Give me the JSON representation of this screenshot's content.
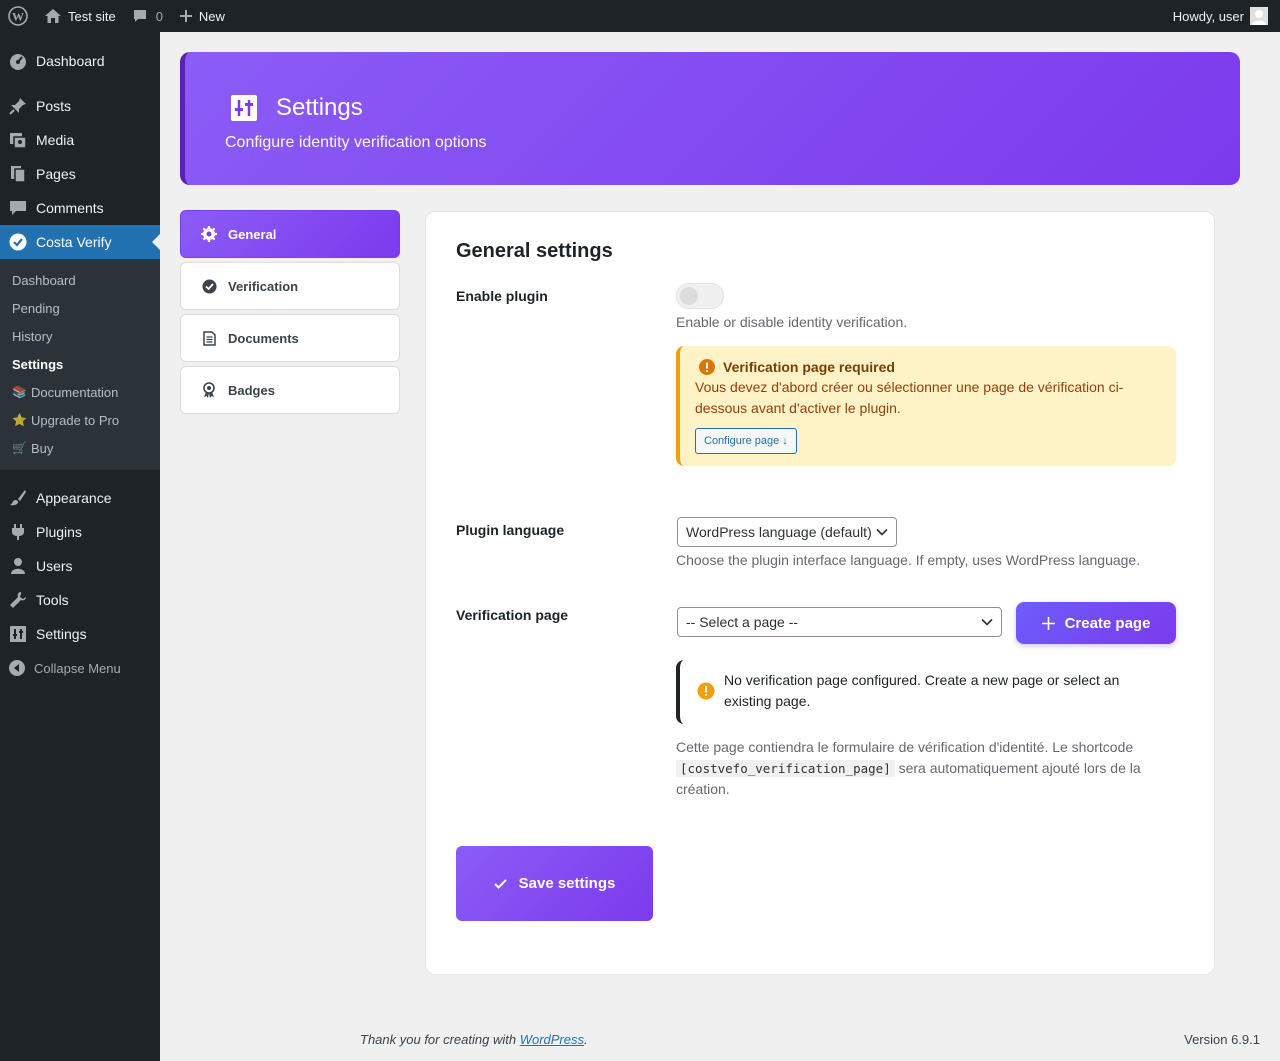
{
  "adminbar": {
    "site_name": "Test site",
    "comments_count": "0",
    "new_label": "New",
    "howdy": "Howdy, user"
  },
  "sidebar": {
    "items": [
      {
        "label": "Dashboard",
        "icon": "dashboard-icon"
      },
      {
        "label": "Posts",
        "icon": "pin-icon"
      },
      {
        "label": "Media",
        "icon": "media-icon"
      },
      {
        "label": "Pages",
        "icon": "pages-icon"
      },
      {
        "label": "Comments",
        "icon": "comment-icon"
      },
      {
        "label": "Costa Verify",
        "icon": "check-circle-icon"
      }
    ],
    "submenu": [
      {
        "label": "Dashboard"
      },
      {
        "label": "Pending"
      },
      {
        "label": "History"
      },
      {
        "label": "Settings"
      },
      {
        "label": "Documentation",
        "emoji": "📚"
      },
      {
        "label": "Upgrade to Pro",
        "emoji": "⭐"
      },
      {
        "label": "Buy",
        "emoji": "🛒"
      }
    ],
    "items_bottom": [
      {
        "label": "Appearance",
        "icon": "brush-icon"
      },
      {
        "label": "Plugins",
        "icon": "plug-icon"
      },
      {
        "label": "Users",
        "icon": "user-icon"
      },
      {
        "label": "Tools",
        "icon": "wrench-icon"
      },
      {
        "label": "Settings",
        "icon": "sliders-icon"
      }
    ],
    "collapse": "Collapse Menu"
  },
  "banner": {
    "title": "Settings",
    "subtitle": "Configure identity verification options"
  },
  "tabs": [
    {
      "label": "General"
    },
    {
      "label": "Verification"
    },
    {
      "label": "Documents"
    },
    {
      "label": "Badges"
    }
  ],
  "panel": {
    "title": "General settings",
    "enable_label": "Enable plugin",
    "enable_desc": "Enable or disable identity verification.",
    "enabled": false,
    "warning_title": "Verification page required",
    "warning_text": "Vous devez d'abord créer ou sélectionner une page de vérification ci-dessous avant d'activer le plugin.",
    "warning_button": "Configure page ↓",
    "language_label": "Plugin language",
    "language_value": "WordPress language (default)",
    "language_desc": "Choose the plugin interface language. If empty, uses WordPress language.",
    "page_label": "Verification page",
    "page_value": "-- Select a page --",
    "create_button": "Create page",
    "notice_text": "No verification page configured. Create a new page or select an existing page.",
    "page_desc_before": "Cette page contiendra le formulaire de vérification d'identité. Le shortcode",
    "page_desc_code": "[costvefo_verification_page]",
    "page_desc_after": "sera automatiquement ajouté lors de la création.",
    "save_button": "Save settings"
  },
  "footer": {
    "thanks_before": "Thank you for creating with",
    "thanks_link": "WordPress",
    "thanks_after": ".",
    "version": "Version 6.9.1"
  },
  "colors": {
    "accent": "#7c3aed",
    "wp_blue": "#2271b1",
    "warning_bg": "#fef3c7",
    "warning_border": "#f59e0b"
  }
}
